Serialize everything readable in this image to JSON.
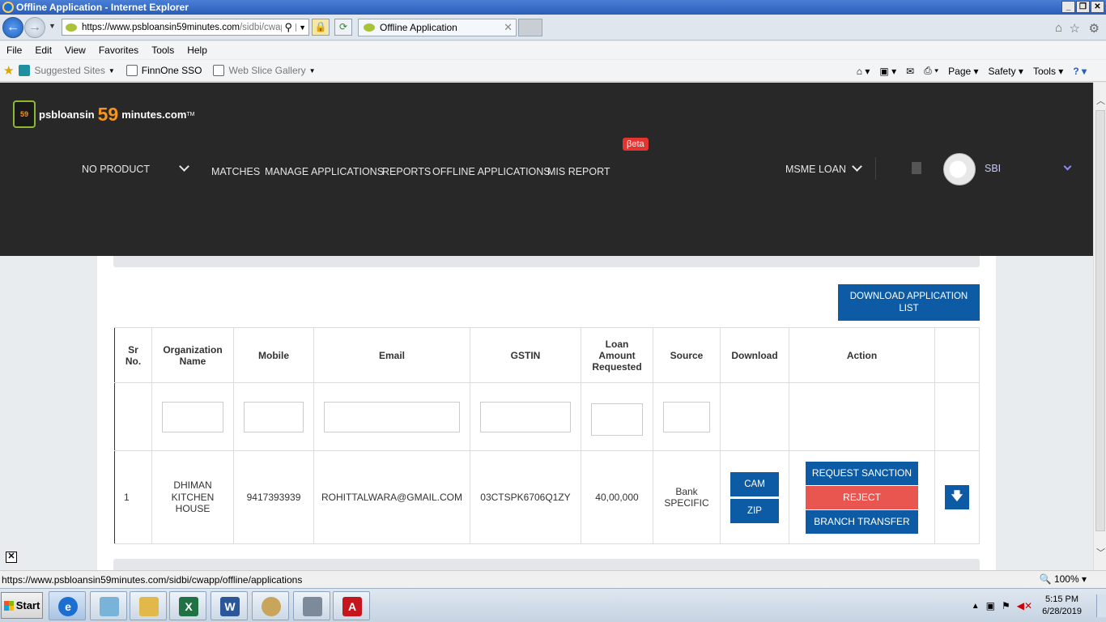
{
  "window": {
    "title": "Offline Application - Internet Explorer",
    "url_prefix": "https://www.",
    "url_domain": "psbloansin59minutes.com",
    "url_path": "/sidbi/cwapp",
    "tab_label": "Offline Application"
  },
  "menubar": [
    "File",
    "Edit",
    "View",
    "Favorites",
    "Tools",
    "Help"
  ],
  "favorites": {
    "suggested": "Suggested Sites",
    "finnone": "FinnOne SSO",
    "webslice": "Web Slice Gallery"
  },
  "commandbar": {
    "page": "Page",
    "safety": "Safety",
    "tools": "Tools"
  },
  "app": {
    "logo": {
      "part1": "psbloansin",
      "part2": "59",
      "part3": "minutes.com",
      "tm": "TM",
      "seal_text": "59"
    },
    "product_select": "NO PRODUCT",
    "nav": {
      "matches": "MATCHES",
      "manage": "MANAGE APPLICATIONS",
      "reports": "REPORTS",
      "offline": "OFFLINE APPLICATIONS",
      "mis": "MIS REPORT"
    },
    "beta": "βeta",
    "loan_select": "MSME LOAN",
    "user": "SBI"
  },
  "download_button": "DOWNLOAD APPLICATION LIST",
  "table": {
    "headers": {
      "sr": [
        "Sr",
        "No."
      ],
      "org": [
        "Organization",
        "Name"
      ],
      "mobile": "Mobile",
      "email": "Email",
      "gstin": "GSTIN",
      "loan": [
        "Loan",
        "Amount",
        "Requested"
      ],
      "source": "Source",
      "download": "Download",
      "action": "Action"
    },
    "row": {
      "sr": "1",
      "org": [
        "DHIMAN",
        "KITCHEN",
        "HOUSE"
      ],
      "mobile": "9417393939",
      "email": "ROHITTALWARA@GMAIL.COM",
      "gstin": "03CTSPK6706Q1ZY",
      "loan": "40,00,000",
      "source": [
        "Bank",
        "SPECIFIC"
      ],
      "cam": "CAM",
      "zip": "ZIP",
      "request_sanction": "REQUEST SANCTION",
      "reject": "REJECT",
      "branch_transfer": "BRANCH TRANSFER"
    }
  },
  "statusbar": {
    "url": "https://www.psbloansin59minutes.com/sidbi/cwapp/offline/applications",
    "zoom": "100%"
  },
  "taskbar": {
    "start": "Start",
    "time": "5:15 PM",
    "date": "6/28/2019"
  }
}
